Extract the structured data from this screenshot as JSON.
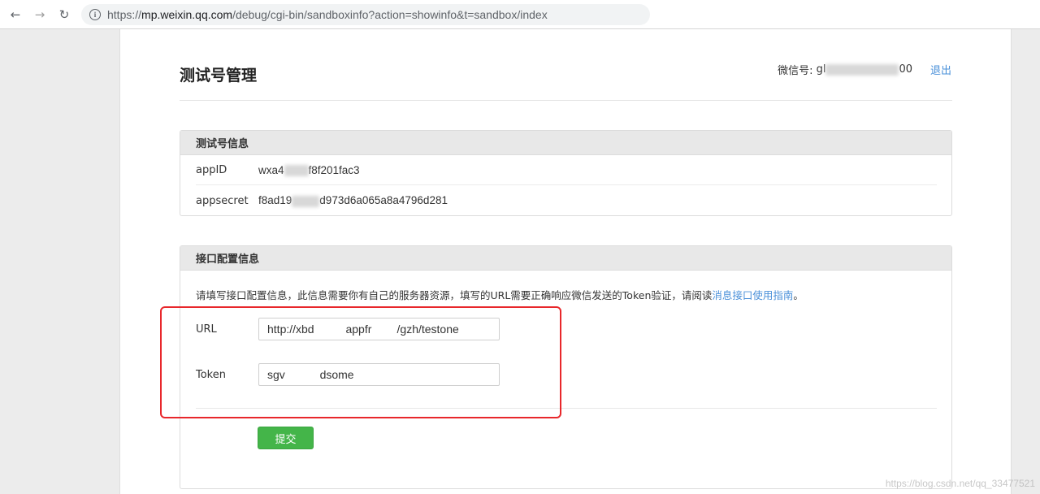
{
  "browser": {
    "url_scheme": "https://",
    "url_host": "mp.weixin.qq.com",
    "url_path": "/debug/cgi-bin/sandboxinfo?action=showinfo&t=sandbox/index"
  },
  "header": {
    "title": "测试号管理",
    "account_label": "微信号:",
    "account_prefix": "gl",
    "account_suffix": "00",
    "logout": "退出"
  },
  "test_account_panel": {
    "heading": "测试号信息",
    "rows": [
      {
        "key": "appID",
        "value_start": "wxa4",
        "value_end": "f8f201fac3"
      },
      {
        "key": "appsecret",
        "value_start": "f8ad19",
        "value_end": "d973d6a065a8a4796d281"
      }
    ]
  },
  "interface_panel": {
    "heading": "接口配置信息",
    "description": "请填写接口配置信息，此信息需要你有自己的服务器资源，填写的URL需要正确响应微信发送的Token验证，请阅读",
    "guide_link": "消息接口使用指南",
    "description_end": "。",
    "url_label": "URL",
    "url_value": "http://xbd          appfr        /gzh/testone",
    "token_label": "Token",
    "token_value": "sgv           dsome",
    "submit": "提交"
  },
  "watermark": "https://blog.csdn.net/qq_33477521",
  "colors": {
    "accent_green": "#44b549",
    "link_blue": "#4a90d9",
    "highlight_red": "#e8272b"
  }
}
